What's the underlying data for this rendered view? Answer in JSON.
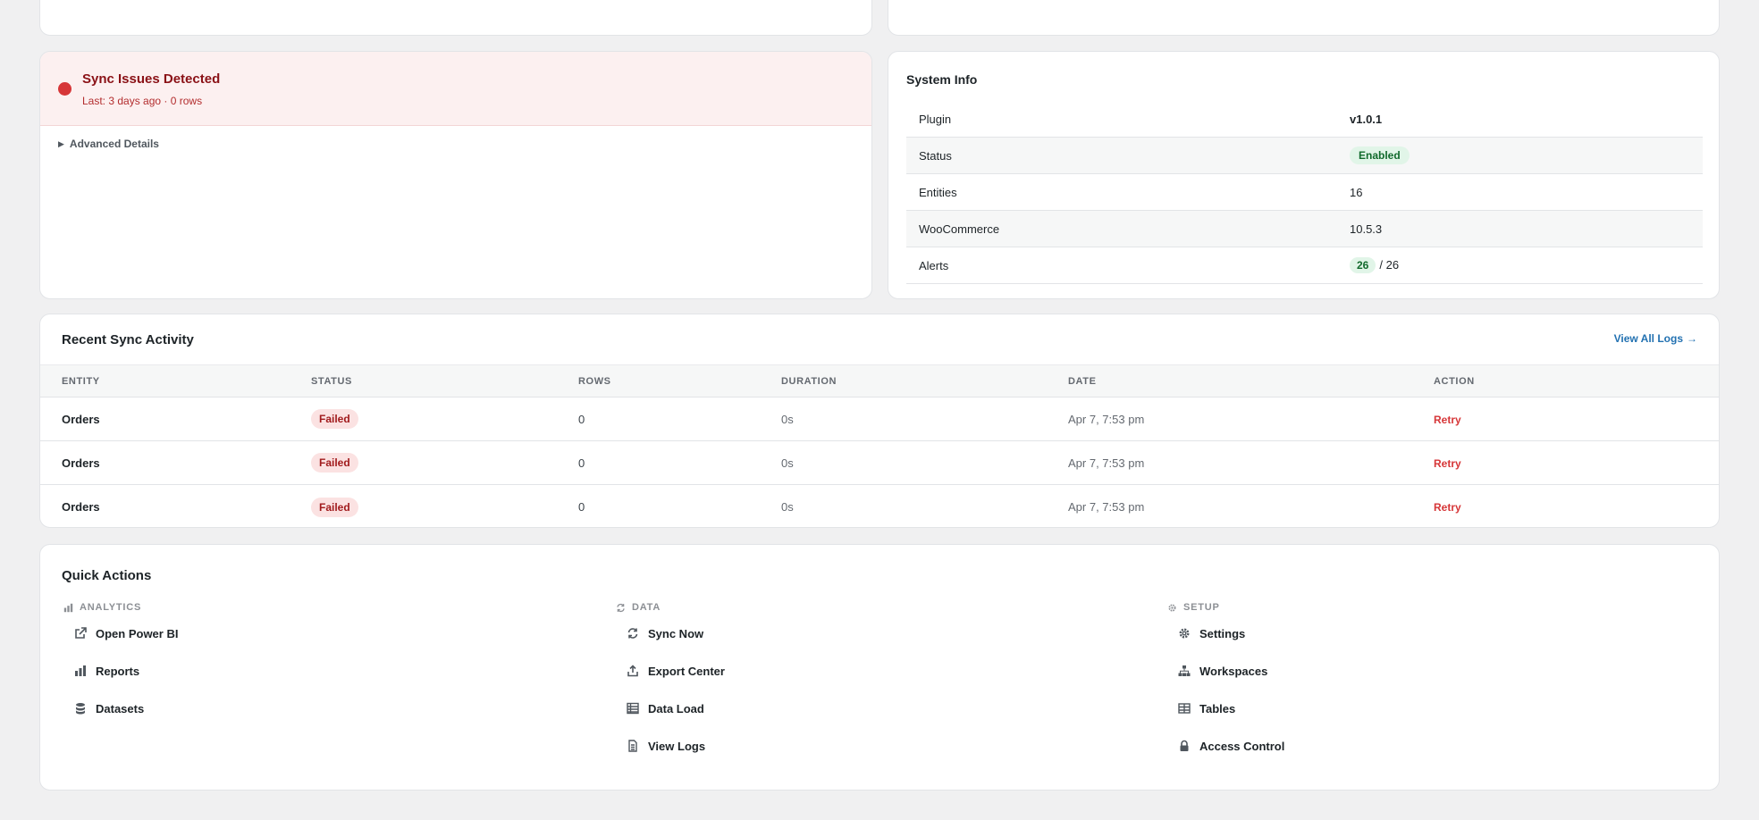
{
  "alert": {
    "title": "Sync Issues Detected",
    "subtitle": "Last: 3 days ago · 0 rows",
    "advanced_label": "Advanced Details",
    "color": "#d63638"
  },
  "system_info": {
    "title": "System Info",
    "rows": [
      {
        "label": "Plugin",
        "value": "v1.0.1"
      },
      {
        "label": "Status",
        "value": "Enabled"
      },
      {
        "label": "Entities",
        "value": "16"
      },
      {
        "label": "WooCommerce",
        "value": "10.5.3"
      },
      {
        "label": "Alerts",
        "value": "26",
        "total": "/ 26"
      }
    ]
  },
  "activity": {
    "title": "Recent Sync Activity",
    "view_all_label": "View All Logs",
    "view_all_arrow": "→",
    "columns": [
      "ENTITY",
      "STATUS",
      "ROWS",
      "DURATION",
      "DATE",
      "ACTION"
    ],
    "rows": [
      {
        "entity": "Orders",
        "status": "Failed",
        "rows": "0",
        "duration": "0s",
        "date": "Apr 7, 7:53 pm",
        "action": "Retry"
      },
      {
        "entity": "Orders",
        "status": "Failed",
        "rows": "0",
        "duration": "0s",
        "date": "Apr 7, 7:53 pm",
        "action": "Retry"
      },
      {
        "entity": "Orders",
        "status": "Failed",
        "rows": "0",
        "duration": "0s",
        "date": "Apr 7, 7:53 pm",
        "action": "Retry"
      }
    ]
  },
  "quick_actions": {
    "title": "Quick Actions",
    "groups": [
      {
        "heading": "ANALYTICS",
        "icon": "bar-chart-icon",
        "items": [
          {
            "label": "Open Power BI",
            "icon": "external-link-icon"
          },
          {
            "label": "Reports",
            "icon": "bar-chart-icon"
          },
          {
            "label": "Datasets",
            "icon": "database-icon"
          }
        ]
      },
      {
        "heading": "DATA",
        "icon": "sync-icon",
        "items": [
          {
            "label": "Sync Now",
            "icon": "sync-icon"
          },
          {
            "label": "Export Center",
            "icon": "upload-icon"
          },
          {
            "label": "Data Load",
            "icon": "table-list-icon"
          },
          {
            "label": "View Logs",
            "icon": "file-icon"
          }
        ]
      },
      {
        "heading": "SETUP",
        "icon": "gear-icon",
        "items": [
          {
            "label": "Settings",
            "icon": "gear-icon"
          },
          {
            "label": "Workspaces",
            "icon": "sitemap-icon"
          },
          {
            "label": "Tables",
            "icon": "table-icon"
          },
          {
            "label": "Access Control",
            "icon": "lock-icon"
          }
        ]
      }
    ]
  }
}
